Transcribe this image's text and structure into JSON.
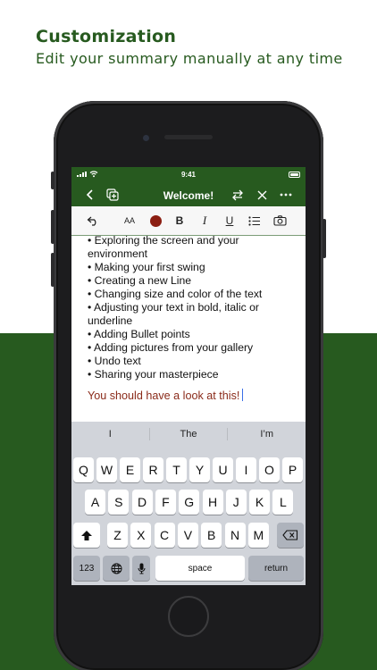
{
  "header": {
    "title": "Customization",
    "subtitle": "Edit your summary manually at any time"
  },
  "status_bar": {
    "time": "9:41"
  },
  "nav": {
    "title": "Welcome!"
  },
  "toolbar": {
    "font_size_label": "AA",
    "bold_label": "B",
    "italic_label": "I",
    "underline_label": "U",
    "text_color": "#8b1e12"
  },
  "document": {
    "lines": [
      "• Exploring the screen and your",
      "environment",
      "• Making your first swing",
      "• Creating a new Line",
      "• Changing size and color of the text",
      "• Adjusting your text in bold, italic or",
      "underline",
      "• Adding Bullet points",
      "• Adding pictures from your gallery",
      "• Undo text",
      "• Sharing your masterpiece"
    ],
    "highlight_line": "You should have a look at this!",
    "highlight_color": "#8a2a19"
  },
  "keyboard": {
    "suggestions": [
      "I",
      "The",
      "I’m"
    ],
    "row1": [
      "Q",
      "W",
      "E",
      "R",
      "T",
      "Y",
      "U",
      "I",
      "O",
      "P"
    ],
    "row2": [
      "A",
      "S",
      "D",
      "F",
      "G",
      "H",
      "J",
      "K",
      "L"
    ],
    "row3": [
      "Z",
      "X",
      "C",
      "V",
      "B",
      "N",
      "M"
    ],
    "numbers_label": "123",
    "space_label": "space",
    "return_label": "return"
  },
  "colors": {
    "brand_green": "#275a1f",
    "text_color_swatch": "#8b1e12"
  }
}
